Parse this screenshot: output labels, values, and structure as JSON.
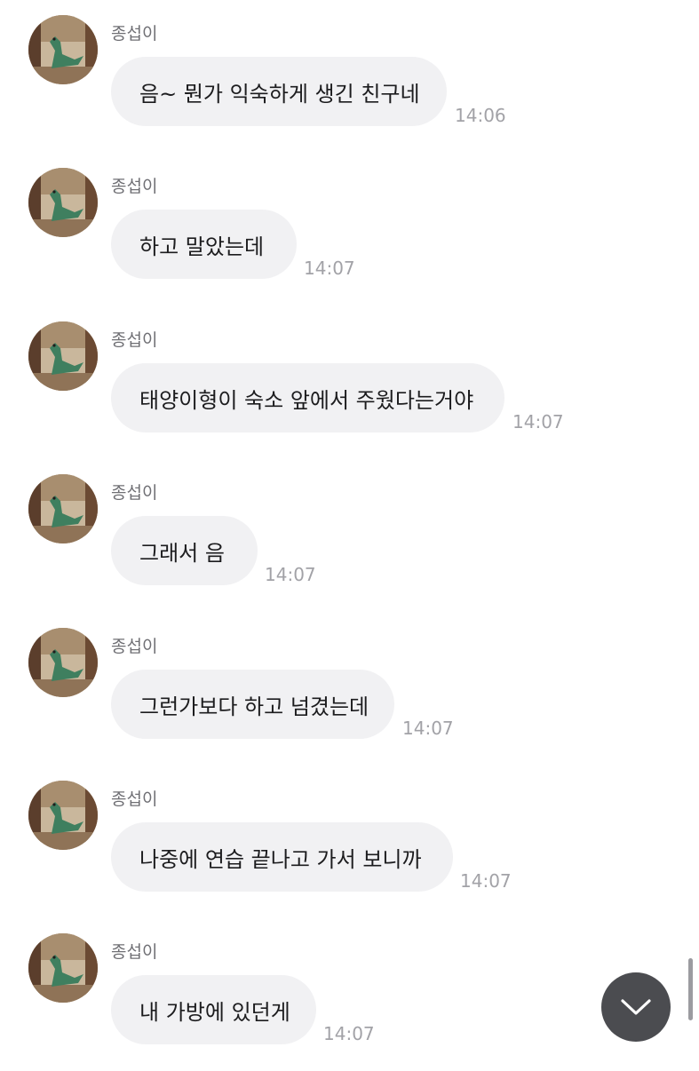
{
  "messages": [
    {
      "sender": "종섭이",
      "text": "음~ 뭔가 익숙하게 생긴 친구네",
      "time": "14:06"
    },
    {
      "sender": "종섭이",
      "text": "하고 말았는데",
      "time": "14:07"
    },
    {
      "sender": "종섭이",
      "text": "태양이형이 숙소 앞에서 주웠다는거야",
      "time": "14:07"
    },
    {
      "sender": "종섭이",
      "text": "그래서 음",
      "time": "14:07"
    },
    {
      "sender": "종섭이",
      "text": "그런가보다 하고 넘겼는데",
      "time": "14:07"
    },
    {
      "sender": "종섭이",
      "text": "나중에 연습 끝나고 가서 보니까",
      "time": "14:07"
    },
    {
      "sender": "종섭이",
      "text": "내 가방에 있던게",
      "time": "14:07"
    }
  ],
  "icons": {
    "avatar": "dinosaur-photo",
    "scroll_down": "chevron-down-icon"
  },
  "colors": {
    "bubble": "#f1f1f3",
    "scroll_button": "#4b4c50",
    "time": "#a2a2a7",
    "sender": "#6f6f74"
  }
}
